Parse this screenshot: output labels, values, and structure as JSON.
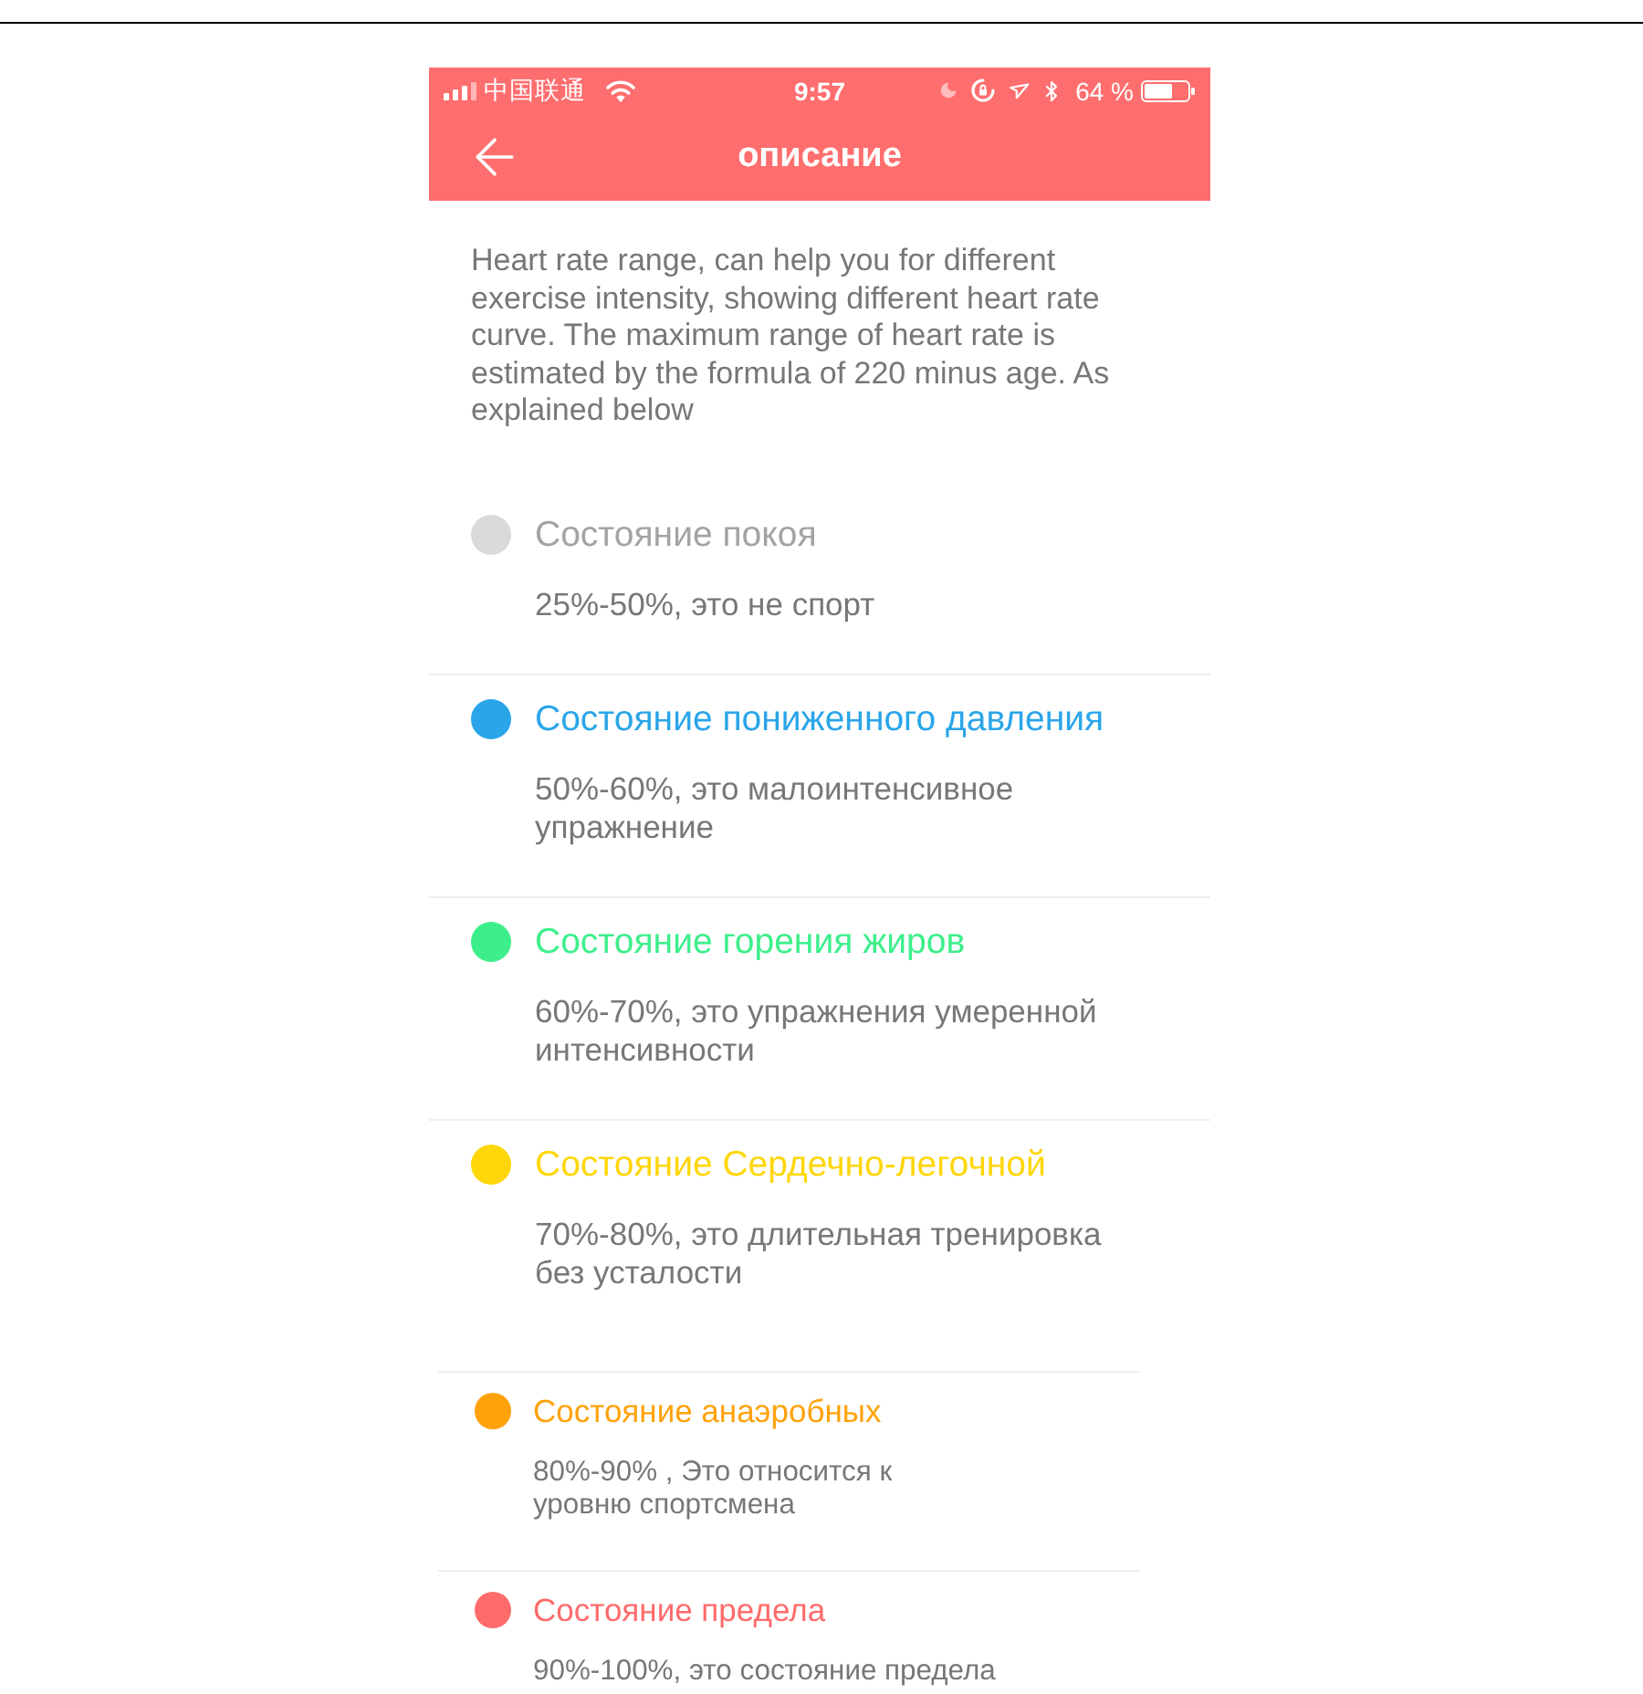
{
  "status_bar": {
    "carrier": "中国联通",
    "time": "9:57",
    "battery": "64 %"
  },
  "header": {
    "title": "описание"
  },
  "description": "Heart rate range, can help you for different exercise intensity, showing different heart rate curve. The maximum range of heart rate is estimated by the formula of 220 minus age. As explained below",
  "zones": [
    {
      "kind": "regular",
      "dot": {
        "color": "#dadada"
      },
      "heading": {
        "text": "Состояние покоя",
        "color": "#a3a3a3"
      },
      "detail": "25%-50%, это не спорт"
    },
    {
      "kind": "regular",
      "dot": {
        "color": "#2aa5e9"
      },
      "heading": {
        "text": "Состояние пониженного давления",
        "color": "#2aa5e9"
      },
      "detail": "50%-60%, это малоинтенсивное упражнение"
    },
    {
      "kind": "regular",
      "dot": {
        "color": "#3def8b"
      },
      "heading": {
        "text": "Состояние горения жиров",
        "color": "#3def8b"
      },
      "detail": "60%-70%, это упражнения умеренной интенсивности"
    },
    {
      "kind": "regular",
      "dot": {
        "color": "#ffd60a"
      },
      "heading": {
        "text": "Состояние Сердечно-легочной",
        "color": "#ffd60a"
      },
      "detail": "70%-80%, это длительная тренировка без усталости"
    },
    {
      "kind": "compact",
      "dot": {
        "color": "#ffa20a"
      },
      "heading": {
        "text": "Состояние анаэробных",
        "color": "#ffa20a"
      },
      "detail": "80%-90% , Это относится к\nуровню спортсмена"
    },
    {
      "kind": "compact",
      "dot": {
        "color": "#ff6b6b"
      },
      "heading": {
        "text": "Состояние предела",
        "color": "#ff6b6b"
      },
      "detail": "90%-100%, это состояние предела"
    }
  ]
}
